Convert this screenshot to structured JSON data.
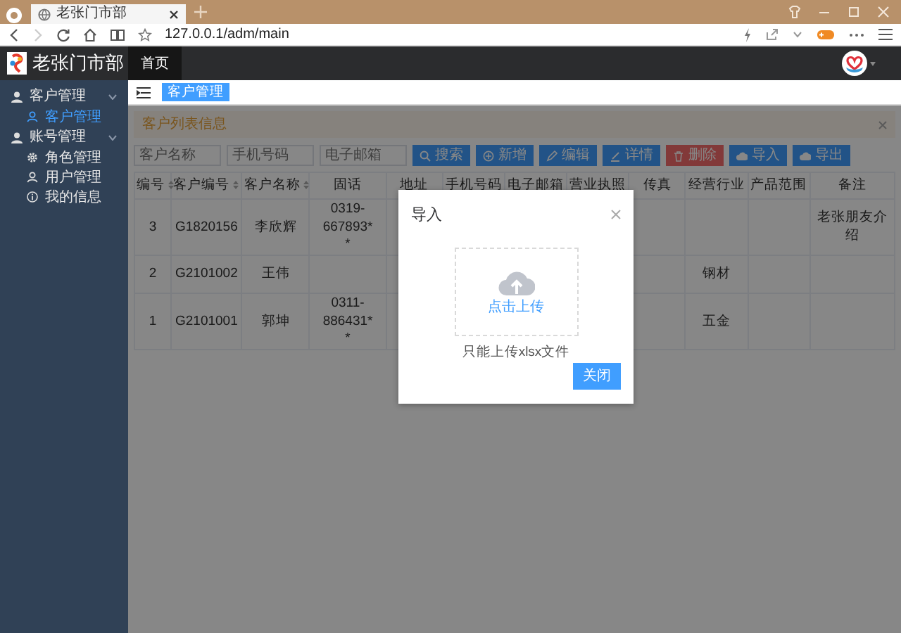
{
  "browser": {
    "tab_title": "老张门市部",
    "url": "127.0.0.1/adm/main"
  },
  "app": {
    "brand": "老张门市部",
    "top_nav": [
      {
        "label": "首页",
        "selected": true
      }
    ]
  },
  "sidebar": {
    "groups": [
      {
        "label": "客户管理",
        "expanded": true,
        "children": [
          {
            "label": "客户管理",
            "kind": "user",
            "selected": true
          }
        ]
      },
      {
        "label": "账号管理",
        "expanded": true,
        "children": [
          {
            "label": "角色管理",
            "kind": "gear",
            "selected": false
          },
          {
            "label": "用户管理",
            "kind": "user",
            "selected": false
          },
          {
            "label": "我的信息",
            "kind": "info",
            "selected": false
          }
        ]
      }
    ]
  },
  "tabs": [
    {
      "label": "客户管理",
      "selected": true
    }
  ],
  "notice": {
    "text": "客户列表信息"
  },
  "search_fields": [
    {
      "placeholder": "客户名称"
    },
    {
      "placeholder": "手机号码"
    },
    {
      "placeholder": "电子邮箱"
    }
  ],
  "toolbar_buttons": [
    {
      "label": "搜索",
      "kind": "search"
    },
    {
      "label": "新增",
      "kind": "add"
    },
    {
      "label": "编辑",
      "kind": "edit"
    },
    {
      "label": "详情",
      "kind": "detail"
    },
    {
      "label": "删除",
      "kind": "delete"
    },
    {
      "label": "导入",
      "kind": "import"
    },
    {
      "label": "导出",
      "kind": "export"
    }
  ],
  "table": {
    "columns": [
      {
        "label": "编号",
        "sortable": true
      },
      {
        "label": "客户编号",
        "sortable": true
      },
      {
        "label": "客户名称",
        "sortable": true
      },
      {
        "label": "固话",
        "sortable": false
      },
      {
        "label": "地址",
        "sortable": false
      },
      {
        "label": "手机号码",
        "sortable": false
      },
      {
        "label": "电子邮箱",
        "sortable": false
      },
      {
        "label": "营业执照",
        "sortable": false
      },
      {
        "label": "传真",
        "sortable": false
      },
      {
        "label": "经营行业",
        "sortable": false
      },
      {
        "label": "产品范围",
        "sortable": false
      },
      {
        "label": "备注",
        "sortable": false
      }
    ],
    "rows": [
      {
        "cells": [
          "3",
          "G1820156",
          "李欣辉",
          [
            "0319-667893*",
            "*"
          ],
          null,
          null,
          null,
          null,
          null,
          null,
          null,
          "老张朋友介绍"
        ]
      },
      {
        "cells": [
          "2",
          "G2101002",
          "王伟",
          null,
          null,
          null,
          null,
          null,
          null,
          "钢材",
          null,
          null
        ]
      },
      {
        "cells": [
          "1",
          "G2101001",
          "郭坤",
          [
            "0311-886431*",
            "*"
          ],
          null,
          null,
          null,
          null,
          null,
          "五金",
          null,
          null
        ]
      }
    ]
  },
  "dialog": {
    "title": "导入",
    "upload_text": "点击上传",
    "hint": "只能上传xlsx文件",
    "button": "关闭"
  }
}
